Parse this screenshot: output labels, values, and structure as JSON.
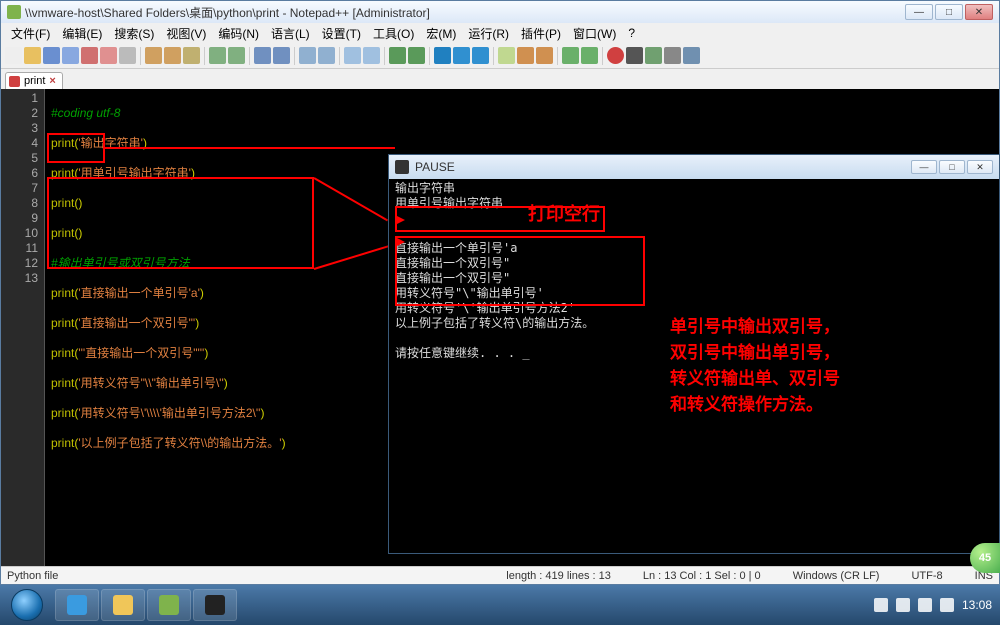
{
  "title": "\\\\vmware-host\\Shared Folders\\桌面\\python\\print - Notepad++ [Administrator]",
  "menu": [
    "文件(F)",
    "编辑(E)",
    "搜索(S)",
    "视图(V)",
    "编码(N)",
    "语言(L)",
    "设置(T)",
    "工具(O)",
    "宏(M)",
    "运行(R)",
    "插件(P)",
    "窗口(W)",
    "?"
  ],
  "tab": {
    "name": "print",
    "close": "×"
  },
  "lines": [
    "1",
    "2",
    "3",
    "4",
    "5",
    "6",
    "7",
    "8",
    "9",
    "10",
    "11",
    "12",
    "13"
  ],
  "code": {
    "l1": "#coding utf-8",
    "l2a": "print",
    "l2b": "(",
    "l2c": "'输出字符串'",
    "l2d": ")",
    "l3a": "print",
    "l3b": "(",
    "l3c": "'用单引号输出字符串'",
    "l3d": ")",
    "l4a": "print",
    "l4b": "()",
    "l5a": "print",
    "l5b": "()",
    "l6": "#输出单引号或双引号方法",
    "l7a": "print",
    "l7b": "(",
    "l7c": "'直接输出一个单引号'a'",
    "l7d": ")",
    "l8a": "print",
    "l8b": "(",
    "l8c": "'直接输出一个双引号\"'",
    "l8d": ")",
    "l9a": "print",
    "l9b": "(",
    "l9c": "'''直接输出一个双引号\"'''",
    "l9d": ")",
    "l10a": "print",
    "l10b": "(",
    "l10c": "'用转义符号\"\\\\\"输出单引号\\''",
    "l10d": ")",
    "l11a": "print",
    "l11b": "(",
    "l11c": "'用转义符号\\'\\\\\\\\'输出单引号方法2\\''",
    "l11d": ")",
    "l12a": "print",
    "l12b": "(",
    "l12c": "'以上例子包括了转义符\\\\的输出方法。'",
    "l12d": ")"
  },
  "console": {
    "title": "PAUSE",
    "out": "输出字符串\n用单引号输出字符串\n\n\n直接输出一个单引号'a\n直接输出一个双引号\"\n直接输出一个双引号\"\n用转义符号\"\\\"输出单引号'\n用转义符号'\\'输出单引号方法2'\n以上例子包括了转义符\\的输出方法。\n\n请按任意键继续. . . _"
  },
  "ann": {
    "a1": "打印空行",
    "a2": "单引号中输出双引号，",
    "a3": "双引号中输出单引号，",
    "a4": "转义符输出单、双引号",
    "a5": "和转义符操作方法。"
  },
  "status": {
    "type": "Python file",
    "len": "length : 419    lines : 13",
    "pos": "Ln : 13    Col : 1    Sel : 0 | 0",
    "eol": "Windows (CR LF)",
    "enc": "UTF-8",
    "ins": "INS"
  },
  "clock": "13:08",
  "fab": "45"
}
